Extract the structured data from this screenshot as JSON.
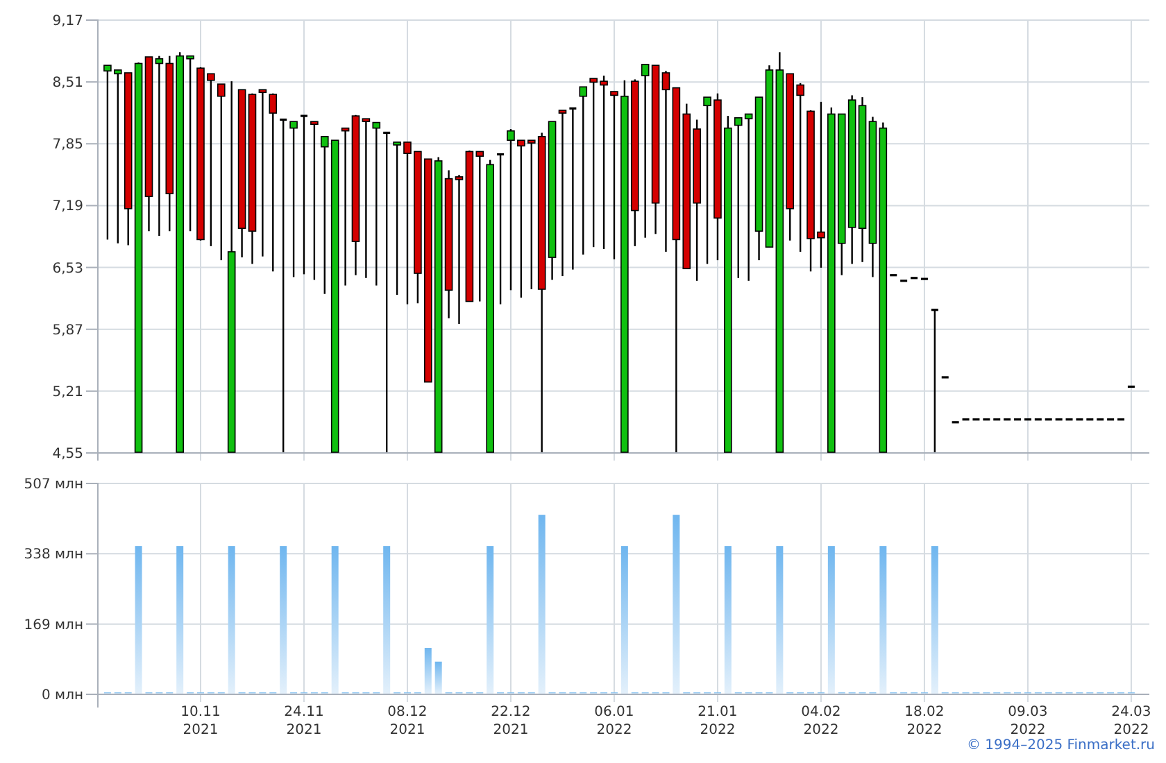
{
  "price_chart": {
    "chart_data": {
      "type": "candlestick",
      "grid": true,
      "categories": [
        null,
        null,
        null,
        null,
        null,
        null,
        null,
        null,
        null,
        null,
        null,
        null,
        null,
        null,
        null,
        null,
        null,
        null,
        null,
        null,
        null,
        null,
        null,
        null,
        null,
        null,
        null,
        null,
        null,
        null,
        null,
        null,
        null,
        null,
        null,
        null,
        null,
        null,
        null,
        null,
        null,
        null,
        null,
        null,
        null,
        null,
        null,
        null,
        null,
        null,
        null,
        null,
        null,
        null,
        null,
        null,
        null,
        null,
        null,
        null,
        null,
        null,
        null,
        null,
        null,
        null,
        null,
        null,
        null,
        null,
        null,
        null,
        null,
        null,
        null,
        null,
        null,
        null,
        null,
        null,
        null,
        null,
        null,
        null,
        null,
        null,
        null,
        null,
        null,
        null,
        null,
        null,
        null,
        null,
        null,
        null,
        null,
        null,
        null,
        null
      ],
      "ylim": [
        4.55,
        9.17
      ],
      "yticks": [
        {
          "value": 4.55,
          "label": "4,55"
        },
        {
          "value": 5.21,
          "label": "5,21"
        },
        {
          "value": 5.87,
          "label": "5,87"
        },
        {
          "value": 6.53,
          "label": "6,53"
        },
        {
          "value": 7.19,
          "label": "7,19"
        },
        {
          "value": 7.85,
          "label": "7,85"
        },
        {
          "value": 8.51,
          "label": "8,51"
        },
        {
          "value": 9.17,
          "label": "9,17"
        }
      ],
      "ohlc": [
        [
          8.62,
          8.68,
          6.82,
          8.68
        ],
        [
          8.59,
          8.63,
          6.78,
          8.63
        ],
        [
          8.6,
          8.6,
          6.76,
          7.15
        ],
        [
          4.55,
          8.71,
          4.55,
          8.7
        ],
        [
          8.77,
          8.77,
          6.91,
          7.28
        ],
        [
          8.7,
          8.78,
          6.86,
          8.75
        ],
        [
          8.7,
          8.78,
          6.91,
          7.31
        ],
        [
          4.55,
          8.82,
          4.55,
          8.78
        ],
        [
          8.75,
          8.78,
          6.91,
          8.78
        ],
        [
          8.65,
          8.66,
          6.81,
          6.82
        ],
        [
          8.59,
          8.59,
          6.75,
          8.52
        ],
        [
          8.48,
          8.48,
          6.6,
          8.35
        ],
        [
          4.55,
          8.51,
          4.55,
          6.69
        ],
        [
          8.42,
          8.42,
          6.63,
          6.94
        ],
        [
          8.37,
          8.38,
          6.56,
          6.91
        ],
        [
          8.42,
          8.42,
          6.64,
          8.41
        ],
        [
          8.37,
          8.38,
          6.48,
          8.17
        ],
        [
          8.1,
          8.1,
          4.55,
          8.1
        ],
        [
          8.01,
          8.08,
          6.42,
          8.08
        ],
        [
          8.14,
          8.14,
          6.45,
          8.14
        ],
        [
          8.08,
          8.08,
          6.39,
          8.05
        ],
        [
          7.81,
          7.92,
          6.24,
          7.92
        ],
        [
          4.55,
          7.88,
          4.55,
          7.88
        ],
        [
          8.01,
          8.01,
          6.33,
          7.99
        ],
        [
          8.14,
          8.15,
          6.44,
          6.8
        ],
        [
          8.11,
          8.11,
          6.41,
          8.08
        ],
        [
          8.01,
          8.07,
          6.33,
          8.07
        ],
        [
          7.96,
          7.96,
          4.55,
          7.96
        ],
        [
          7.83,
          7.86,
          6.23,
          7.86
        ],
        [
          7.86,
          7.86,
          6.13,
          7.74
        ],
        [
          7.76,
          7.76,
          6.14,
          6.46
        ],
        [
          7.68,
          7.68,
          5.3,
          5.3
        ],
        [
          4.55,
          7.7,
          4.55,
          7.66
        ],
        [
          7.47,
          7.56,
          5.98,
          6.28
        ],
        [
          7.49,
          7.51,
          5.92,
          7.48
        ],
        [
          7.76,
          7.77,
          6.16,
          6.16
        ],
        [
          7.76,
          7.76,
          6.16,
          7.71
        ],
        [
          4.55,
          7.67,
          4.55,
          7.62
        ],
        [
          7.73,
          7.73,
          6.13,
          7.73
        ],
        [
          7.88,
          8.0,
          6.28,
          7.98
        ],
        [
          7.88,
          7.88,
          6.2,
          7.82
        ],
        [
          7.88,
          7.88,
          6.29,
          7.86
        ],
        [
          7.92,
          7.96,
          4.55,
          6.29
        ],
        [
          6.63,
          8.08,
          6.39,
          8.08
        ],
        [
          8.2,
          8.2,
          6.43,
          8.17
        ],
        [
          8.22,
          8.22,
          6.5,
          8.22
        ],
        [
          8.35,
          8.45,
          6.66,
          8.45
        ],
        [
          8.54,
          8.54,
          6.74,
          8.5
        ],
        [
          8.51,
          8.57,
          6.72,
          8.47
        ],
        [
          8.4,
          8.4,
          6.61,
          8.36
        ],
        [
          4.55,
          8.52,
          4.55,
          8.35
        ],
        [
          8.51,
          8.53,
          6.75,
          7.13
        ],
        [
          8.57,
          8.69,
          6.84,
          8.69
        ],
        [
          8.68,
          8.68,
          6.88,
          7.21
        ],
        [
          8.6,
          8.62,
          6.69,
          8.42
        ],
        [
          8.44,
          8.44,
          4.55,
          6.82
        ],
        [
          8.16,
          8.27,
          6.51,
          6.51
        ],
        [
          8.0,
          8.1,
          6.38,
          7.21
        ],
        [
          8.25,
          8.34,
          6.56,
          8.34
        ],
        [
          8.31,
          8.38,
          6.6,
          7.05
        ],
        [
          4.55,
          8.14,
          4.55,
          8.01
        ],
        [
          8.04,
          8.12,
          6.41,
          8.12
        ],
        [
          8.11,
          8.16,
          6.38,
          8.16
        ],
        [
          6.91,
          8.34,
          6.6,
          8.34
        ],
        [
          6.74,
          8.68,
          6.74,
          8.63
        ],
        [
          4.55,
          8.82,
          4.55,
          8.63
        ],
        [
          8.59,
          8.59,
          6.81,
          7.15
        ],
        [
          8.47,
          8.49,
          6.69,
          8.36
        ],
        [
          8.19,
          8.2,
          6.48,
          6.83
        ],
        [
          6.9,
          8.29,
          6.52,
          6.84
        ],
        [
          4.55,
          8.23,
          4.55,
          8.16
        ],
        [
          6.78,
          8.16,
          6.44,
          8.16
        ],
        [
          6.95,
          8.36,
          6.56,
          8.31
        ],
        [
          6.94,
          8.34,
          6.58,
          8.25
        ],
        [
          6.78,
          8.13,
          6.42,
          8.08
        ],
        [
          4.55,
          8.07,
          4.55,
          8.01
        ],
        [
          6.44,
          6.44,
          6.44,
          6.44
        ],
        [
          6.38,
          6.38,
          6.38,
          6.38
        ],
        [
          6.41,
          6.41,
          6.41,
          6.41
        ],
        [
          6.4,
          6.4,
          6.4,
          6.4
        ],
        [
          6.07,
          6.07,
          4.55,
          6.07
        ],
        [
          5.35,
          5.35,
          5.35,
          5.35
        ],
        [
          4.87,
          4.87,
          4.87,
          4.87
        ],
        [
          4.9,
          4.9,
          4.9,
          4.9
        ],
        [
          4.9,
          4.9,
          4.9,
          4.9
        ],
        [
          4.9,
          4.9,
          4.9,
          4.9
        ],
        [
          4.9,
          4.9,
          4.9,
          4.9
        ],
        [
          4.9,
          4.9,
          4.9,
          4.9
        ],
        [
          4.9,
          4.9,
          4.9,
          4.9
        ],
        [
          4.9,
          4.9,
          4.9,
          4.9
        ],
        [
          4.9,
          4.9,
          4.9,
          4.9
        ],
        [
          4.9,
          4.9,
          4.9,
          4.9
        ],
        [
          4.9,
          4.9,
          4.9,
          4.9
        ],
        [
          4.9,
          4.9,
          4.9,
          4.9
        ],
        [
          4.9,
          4.9,
          4.9,
          4.9
        ],
        [
          4.9,
          4.9,
          4.9,
          4.9
        ],
        [
          4.9,
          4.9,
          4.9,
          4.9
        ],
        [
          4.9,
          4.9,
          4.9,
          4.9
        ],
        [
          4.9,
          4.9,
          4.9,
          4.9
        ],
        [
          5.25,
          5.25,
          5.25,
          5.25
        ]
      ]
    }
  },
  "volume_chart": {
    "chart_data": {
      "type": "bar",
      "grid": true,
      "ylim": [
        0,
        507
      ],
      "yticks": [
        {
          "value": 0,
          "label": "0 млн"
        },
        {
          "value": 169,
          "label": "169 млн"
        },
        {
          "value": 338,
          "label": "338 млн"
        },
        {
          "value": 507,
          "label": "507 млн"
        }
      ],
      "categories": [
        null,
        null,
        null,
        null,
        null,
        null,
        null,
        null,
        null,
        "10.11\n2021",
        null,
        null,
        null,
        null,
        null,
        null,
        null,
        null,
        null,
        "24.11\n2021",
        null,
        null,
        null,
        null,
        null,
        null,
        null,
        null,
        null,
        "08.12\n2021",
        null,
        null,
        null,
        null,
        null,
        null,
        null,
        null,
        null,
        "22.12\n2021",
        null,
        null,
        null,
        null,
        null,
        null,
        null,
        null,
        null,
        "06.01\n2022",
        null,
        null,
        null,
        null,
        null,
        null,
        null,
        null,
        null,
        "21.01\n2022",
        null,
        null,
        null,
        null,
        null,
        null,
        null,
        null,
        null,
        "04.02\n2022",
        null,
        null,
        null,
        null,
        null,
        null,
        null,
        null,
        null,
        "18.02\n2022",
        null,
        null,
        null,
        null,
        null,
        null,
        null,
        null,
        null,
        "09.03\n2022",
        null,
        null,
        null,
        null,
        null,
        null,
        null,
        null,
        null,
        "24.03\n2022"
      ],
      "series": [
        {
          "color": "#6fb6ef",
          "values": [
            3,
            3,
            3,
            355,
            3,
            3,
            3,
            355,
            3,
            3,
            3,
            3,
            355,
            3,
            3,
            3,
            3,
            355,
            3,
            3,
            3,
            3,
            355,
            3,
            3,
            3,
            3,
            355,
            3,
            3,
            3,
            110,
            77,
            3,
            3,
            3,
            3,
            355,
            3,
            3,
            3,
            3,
            430,
            3,
            3,
            3,
            3,
            3,
            3,
            3,
            355,
            3,
            3,
            3,
            3,
            430,
            3,
            3,
            3,
            3,
            355,
            3,
            3,
            3,
            3,
            355,
            3,
            3,
            3,
            3,
            355,
            3,
            3,
            3,
            3,
            355,
            3,
            3,
            3,
            3,
            355,
            3,
            3,
            3,
            3,
            3,
            3,
            3,
            3,
            3,
            3,
            3,
            3,
            3,
            3,
            3,
            3,
            3,
            3,
            3
          ]
        }
      ]
    }
  },
  "footer": {
    "copyright": "© 1994–2025 Finmarket.ru"
  }
}
